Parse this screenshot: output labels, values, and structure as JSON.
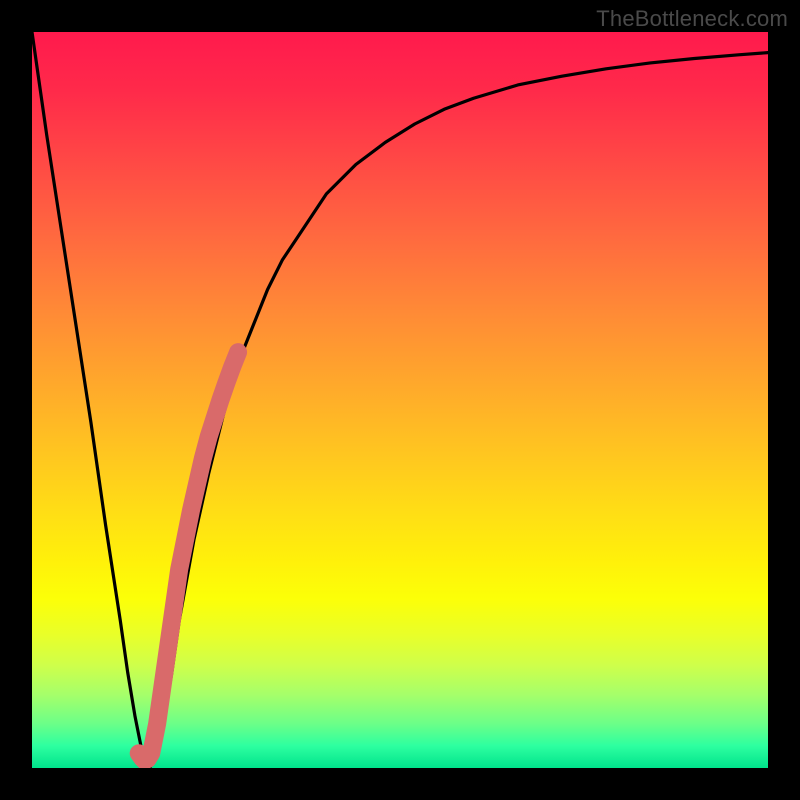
{
  "watermark": "TheBottleneck.com",
  "chart_data": {
    "type": "line",
    "title": "",
    "xlabel": "",
    "ylabel": "",
    "xlim": [
      0,
      100
    ],
    "ylim": [
      0,
      100
    ],
    "grid": false,
    "series": [
      {
        "name": "bottleneck-curve",
        "x": [
          0,
          2,
          4,
          6,
          8,
          10,
          12,
          13,
          14,
          15,
          16,
          17,
          18,
          19,
          20,
          22,
          24,
          26,
          28,
          30,
          32,
          34,
          36,
          38,
          40,
          44,
          48,
          52,
          56,
          60,
          66,
          72,
          78,
          84,
          90,
          96,
          100
        ],
        "values": [
          100,
          86,
          73,
          60,
          47,
          33,
          20,
          13,
          7,
          2,
          0,
          2,
          7,
          13,
          20,
          31,
          40,
          48,
          55,
          60,
          65,
          69,
          72,
          75,
          78,
          82,
          85,
          87.5,
          89.5,
          91,
          92.8,
          94,
          95,
          95.8,
          96.4,
          96.9,
          97.2
        ]
      }
    ],
    "highlight_segment": {
      "name": "highlight-range",
      "color": "#d96a6a",
      "x": [
        14.5,
        15,
        15.3,
        15.7,
        16.2,
        17,
        18,
        20.0,
        20.8,
        21.6,
        22.4,
        23.2,
        24.0,
        24.8,
        25.6,
        26.4,
        27.2,
        28.0
      ],
      "values": [
        2.0,
        1.3,
        1.0,
        1.2,
        2.0,
        6,
        13,
        27,
        31,
        35,
        38.5,
        42,
        45,
        47.5,
        50,
        52.3,
        54.5,
        56.5
      ]
    }
  }
}
